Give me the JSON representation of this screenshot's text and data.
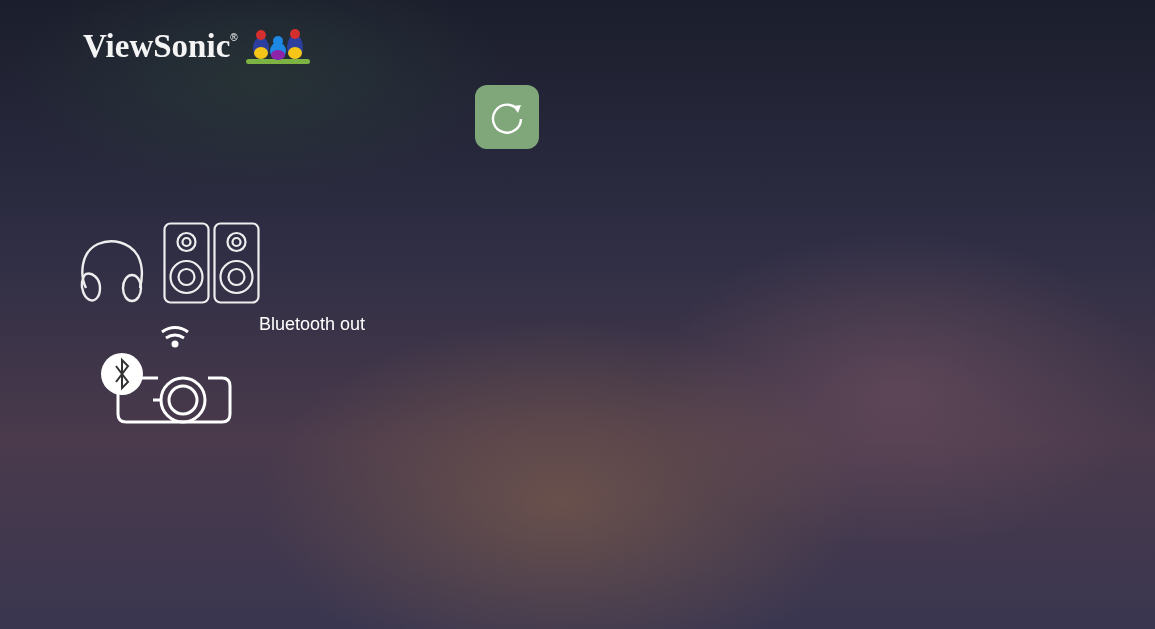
{
  "logo": {
    "text": "ViewSonic",
    "mark": "®"
  },
  "output_option": {
    "label": "Bluetooth out"
  }
}
